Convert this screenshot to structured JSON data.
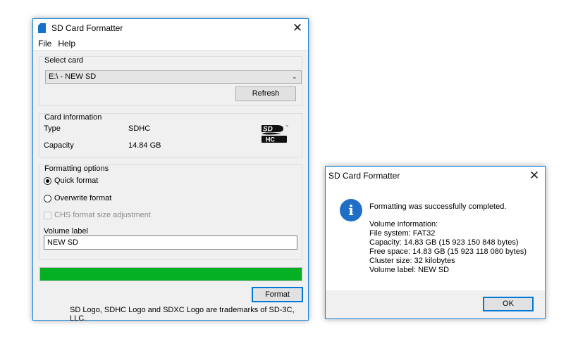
{
  "main_window": {
    "title": "SD Card Formatter",
    "menu": [
      "File",
      "Help"
    ],
    "select_card": {
      "group_title": "Select card",
      "selected": "E:\\ - NEW SD",
      "refresh_label": "Refresh"
    },
    "card_info": {
      "group_title": "Card information",
      "type_label": "Type",
      "type_value": "SDHC",
      "capacity_label": "Capacity",
      "capacity_value": "14.84 GB"
    },
    "formatting_options": {
      "group_title": "Formatting options",
      "quick_format": "Quick format",
      "overwrite_format": "Overwrite format",
      "chs_adjustment": "CHS format size adjustment",
      "volume_label_title": "Volume label",
      "volume_label_value": "NEW SD",
      "selected_option": "quick"
    },
    "progress_fraction": 1.0,
    "format_label": "Format",
    "trademark_text": "SD Logo, SDHC Logo and SDXC Logo are trademarks of SD-3C, LLC."
  },
  "dialog": {
    "title": "SD Card Formatter",
    "message": "Formatting was successfully completed.",
    "lines": [
      "Volume information:",
      "File system: FAT32",
      "Capacity: 14.83 GB (15 923 150 848 bytes)",
      "Free space: 14.83 GB (15 923 118 080 bytes)",
      "Cluster size: 32 kilobytes",
      "Volume label: NEW SD"
    ],
    "ok_label": "OK"
  },
  "colors": {
    "accent": "#0078d7",
    "progress": "#06b025",
    "info_icon": "#1f6fc6"
  },
  "icons": {
    "close": "close-icon",
    "info": "info-icon",
    "app": "sd-card-icon",
    "logo": "sdhc-logo"
  }
}
